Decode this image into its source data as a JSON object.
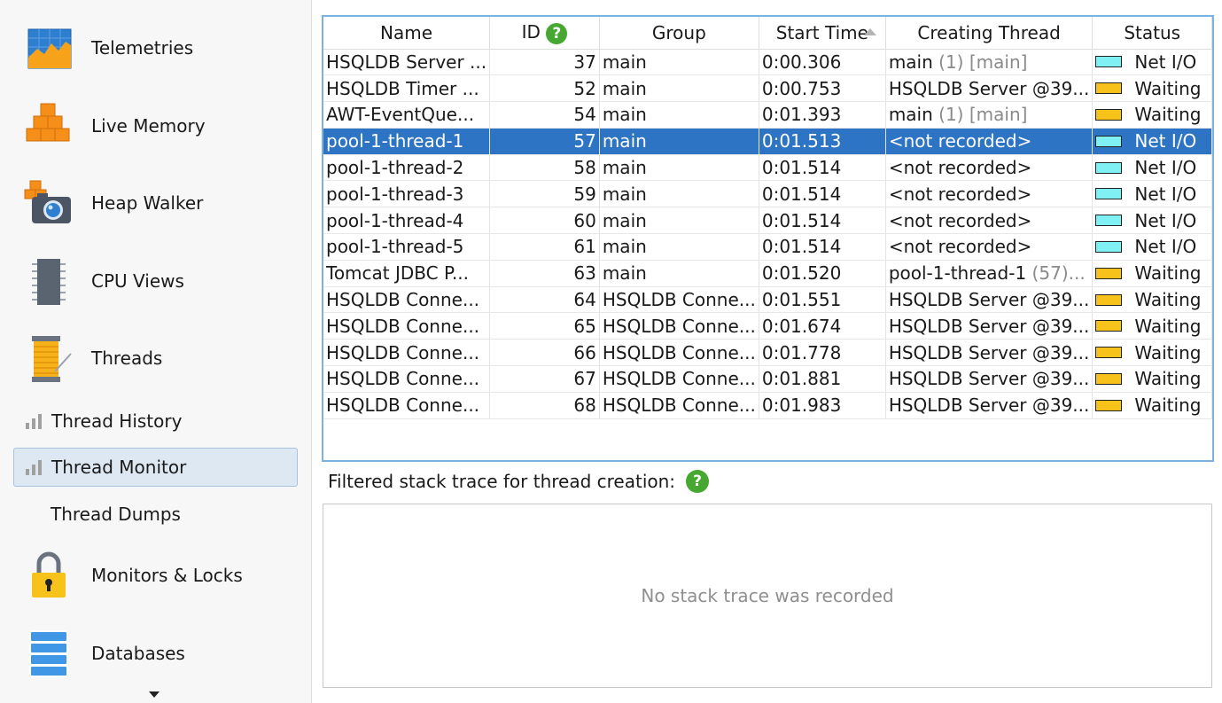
{
  "sidebar": {
    "items": [
      {
        "label": "Telemetries",
        "icon": "telemetries-icon"
      },
      {
        "label": "Live Memory",
        "icon": "live-memory-icon"
      },
      {
        "label": "Heap Walker",
        "icon": "heap-walker-icon"
      },
      {
        "label": "CPU Views",
        "icon": "cpu-views-icon"
      },
      {
        "label": "Threads",
        "icon": "threads-icon"
      },
      {
        "label": "Thread History",
        "icon": "bar-chart-icon"
      },
      {
        "label": "Thread Monitor",
        "icon": "bar-chart-icon",
        "selected": true
      },
      {
        "label": "Thread Dumps"
      },
      {
        "label": "Monitors & Locks",
        "icon": "lock-icon"
      },
      {
        "label": "Databases",
        "icon": "database-icon"
      }
    ]
  },
  "table": {
    "columns": [
      "Name",
      "ID",
      "Group",
      "Start Time",
      "Creating Thread",
      "Status"
    ],
    "sort_column": "Start Time",
    "status_colors": {
      "Net I/O": "#7ff0f4",
      "Waiting": "#f7c21a"
    },
    "rows": [
      {
        "name": "HSQLDB Server ...",
        "id": "37",
        "group": "main",
        "start": "0:00.306",
        "creator": "main",
        "creator_extra": " (1) [main]",
        "status": "Net I/O"
      },
      {
        "name": "HSQLDB Timer ...",
        "id": "52",
        "group": "main",
        "start": "0:00.753",
        "creator": "HSQLDB Server @39...",
        "creator_extra": "",
        "status": "Waiting"
      },
      {
        "name": "AWT-EventQue...",
        "id": "54",
        "group": "main",
        "start": "0:01.393",
        "creator": "main",
        "creator_extra": " (1) [main]",
        "status": "Waiting"
      },
      {
        "name": "pool-1-thread-1",
        "id": "57",
        "group": "main",
        "start": "0:01.513",
        "creator": "<not recorded>",
        "creator_extra": "",
        "status": "Net I/O",
        "selected": true
      },
      {
        "name": "pool-1-thread-2",
        "id": "58",
        "group": "main",
        "start": "0:01.514",
        "creator": "<not recorded>",
        "creator_extra": "",
        "status": "Net I/O"
      },
      {
        "name": "pool-1-thread-3",
        "id": "59",
        "group": "main",
        "start": "0:01.514",
        "creator": "<not recorded>",
        "creator_extra": "",
        "status": "Net I/O"
      },
      {
        "name": "pool-1-thread-4",
        "id": "60",
        "group": "main",
        "start": "0:01.514",
        "creator": "<not recorded>",
        "creator_extra": "",
        "status": "Net I/O"
      },
      {
        "name": "pool-1-thread-5",
        "id": "61",
        "group": "main",
        "start": "0:01.514",
        "creator": "<not recorded>",
        "creator_extra": "",
        "status": "Net I/O"
      },
      {
        "name": "Tomcat JDBC P...",
        "id": "63",
        "group": "main",
        "start": "0:01.520",
        "creator": "pool-1-thread-1",
        "creator_extra": " (57)...",
        "status": "Waiting"
      },
      {
        "name": "HSQLDB Conne...",
        "id": "64",
        "group": "HSQLDB Conne...",
        "start": "0:01.551",
        "creator": "HSQLDB Server @39...",
        "creator_extra": "",
        "status": "Waiting"
      },
      {
        "name": "HSQLDB Conne...",
        "id": "65",
        "group": "HSQLDB Conne...",
        "start": "0:01.674",
        "creator": "HSQLDB Server @39...",
        "creator_extra": "",
        "status": "Waiting"
      },
      {
        "name": "HSQLDB Conne...",
        "id": "66",
        "group": "HSQLDB Conne...",
        "start": "0:01.778",
        "creator": "HSQLDB Server @39...",
        "creator_extra": "",
        "status": "Waiting"
      },
      {
        "name": "HSQLDB Conne...",
        "id": "67",
        "group": "HSQLDB Conne...",
        "start": "0:01.881",
        "creator": "HSQLDB Server @39...",
        "creator_extra": "",
        "status": "Waiting"
      },
      {
        "name": "HSQLDB Conne...",
        "id": "68",
        "group": "HSQLDB Conne...",
        "start": "0:01.983",
        "creator": "HSQLDB Server @39...",
        "creator_extra": "",
        "status": "Waiting"
      }
    ]
  },
  "trace": {
    "label": "Filtered stack trace for thread creation:",
    "empty_message": "No stack trace was recorded"
  },
  "help_glyph": "?"
}
